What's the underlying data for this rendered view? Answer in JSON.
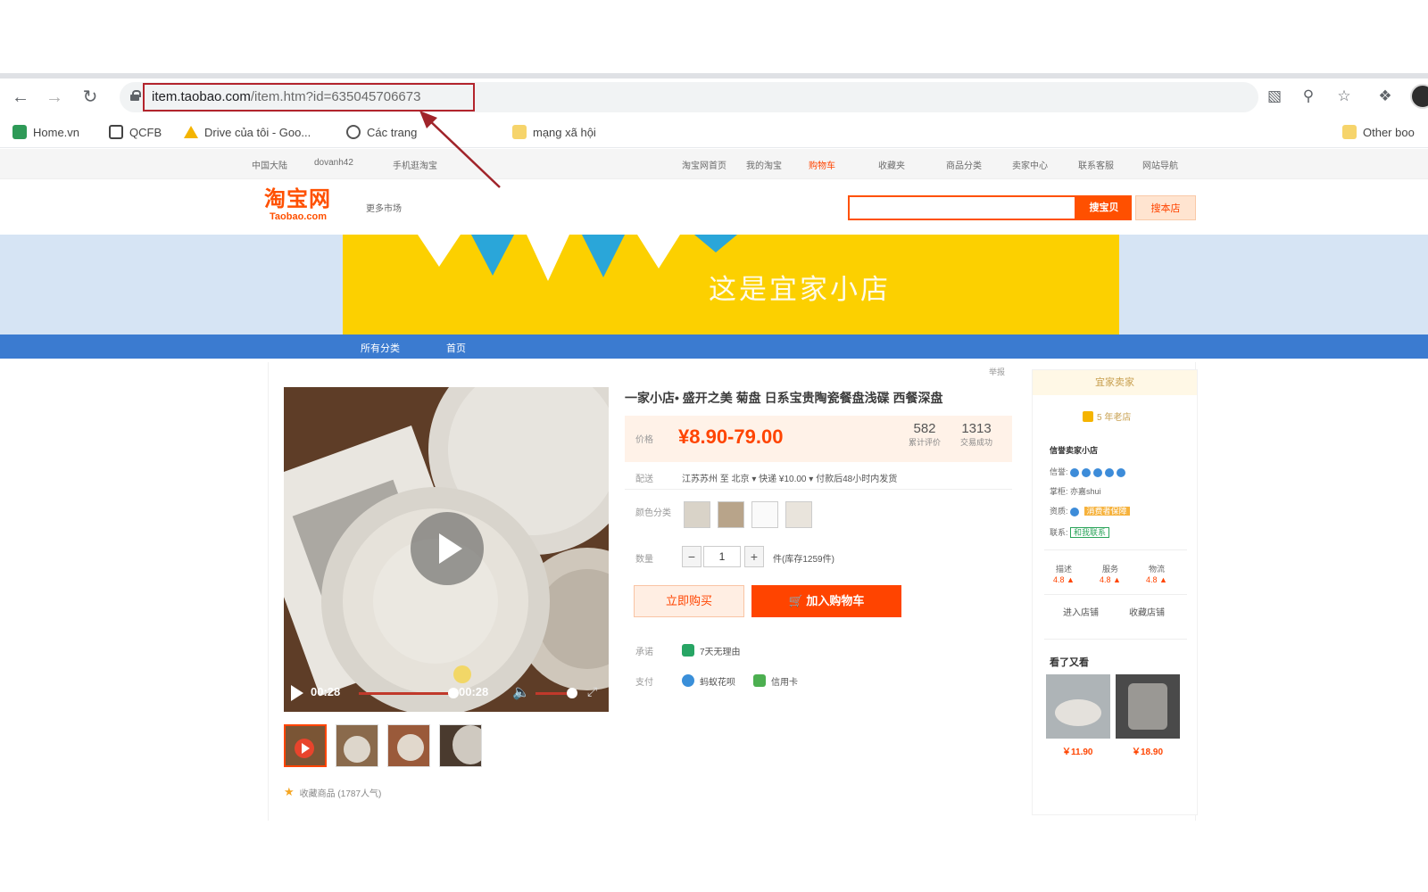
{
  "browser": {
    "url_host": "item.taobao.com",
    "url_path": "/item.htm?id=635045706673",
    "bookmarks": [
      {
        "label": "Home.vn",
        "color": "#2e9a57"
      },
      {
        "label": "QCFB",
        "color": "#444444"
      },
      {
        "label": "Drive của tôi - Goo...",
        "color": "#f4b400"
      },
      {
        "label": "Các trang",
        "color": "#555555"
      },
      {
        "label": "mạng xã hội",
        "color": "#f6d46b"
      }
    ],
    "other_bookmarks": "Other boo"
  },
  "site_nav": {
    "left": [
      "中国大陆",
      "dovanh42",
      "手机逛淘宝"
    ],
    "right": [
      "淘宝网首页",
      "我的淘宝",
      "购物车",
      "收藏夹",
      "商品分类",
      "卖家中心",
      "联系客服",
      "网站导航"
    ]
  },
  "header": {
    "logo_cn": "淘宝网",
    "logo_en": "Taobao.com",
    "more_markets": "更多市场",
    "search_button": "搜宝贝",
    "search_shop_button": "搜本店"
  },
  "banner": {
    "title": "这是宜家小店",
    "colors": {
      "bg": "#fcd000",
      "flag_blue": "#2aa6d9",
      "flag_white": "#ffffff"
    }
  },
  "shop_nav": [
    "所有分类",
    "首页"
  ],
  "product": {
    "report": "举报",
    "title": "一家小店• 盛开之美 菊盘 日系宝贵陶瓷餐盘浅碟 西餐深盘",
    "price_label": "价格",
    "price": "¥8.90-79.00",
    "stats": [
      {
        "num": "582",
        "label": "累计评价"
      },
      {
        "num": "1313",
        "label": "交易成功"
      }
    ],
    "shipping_label": "配送",
    "shipping_text": "江苏苏州 至 北京 ▾   快递 ¥10.00 ▾   付款后48小时内发货",
    "color_label": "颜色分类",
    "qty_label": "数量",
    "qty_value": "1",
    "qty_minus": "−",
    "qty_plus": "+",
    "stock_text": "件(库存1259件)",
    "buy_now": "立即购买",
    "add_to_cart": "加入购物车",
    "promise_label": "承诺",
    "promise_text": "7天无理由",
    "payment_label": "支付",
    "payment_items": [
      "蚂蚁花呗",
      "信用卡"
    ],
    "video": {
      "current": "00:28",
      "duration": "00:28",
      "progress": 0.66,
      "volume": 0.9
    },
    "favorites": "收藏商品 (1787人气)"
  },
  "shop_panel": {
    "title": "宜家卖家",
    "years": "5 年老店",
    "name": "信誉卖家小店",
    "rows": [
      {
        "label": "信誉:",
        "value": ""
      },
      {
        "label": "掌柜:",
        "value": "亦嘉shui"
      },
      {
        "label": "资质:",
        "value": "消费者保障"
      },
      {
        "label": "联系:",
        "value": "和我联系"
      }
    ],
    "scores": [
      {
        "label": "描述",
        "value": "4.8 ▲"
      },
      {
        "label": "服务",
        "value": "4.8 ▲"
      },
      {
        "label": "物流",
        "value": "4.8 ▲"
      }
    ],
    "enter_shop": "进入店铺",
    "fav_shop": "收藏店铺",
    "viewed_title": "看了又看",
    "viewed": [
      {
        "price": "￥11.90"
      },
      {
        "price": "￥18.90"
      }
    ]
  }
}
